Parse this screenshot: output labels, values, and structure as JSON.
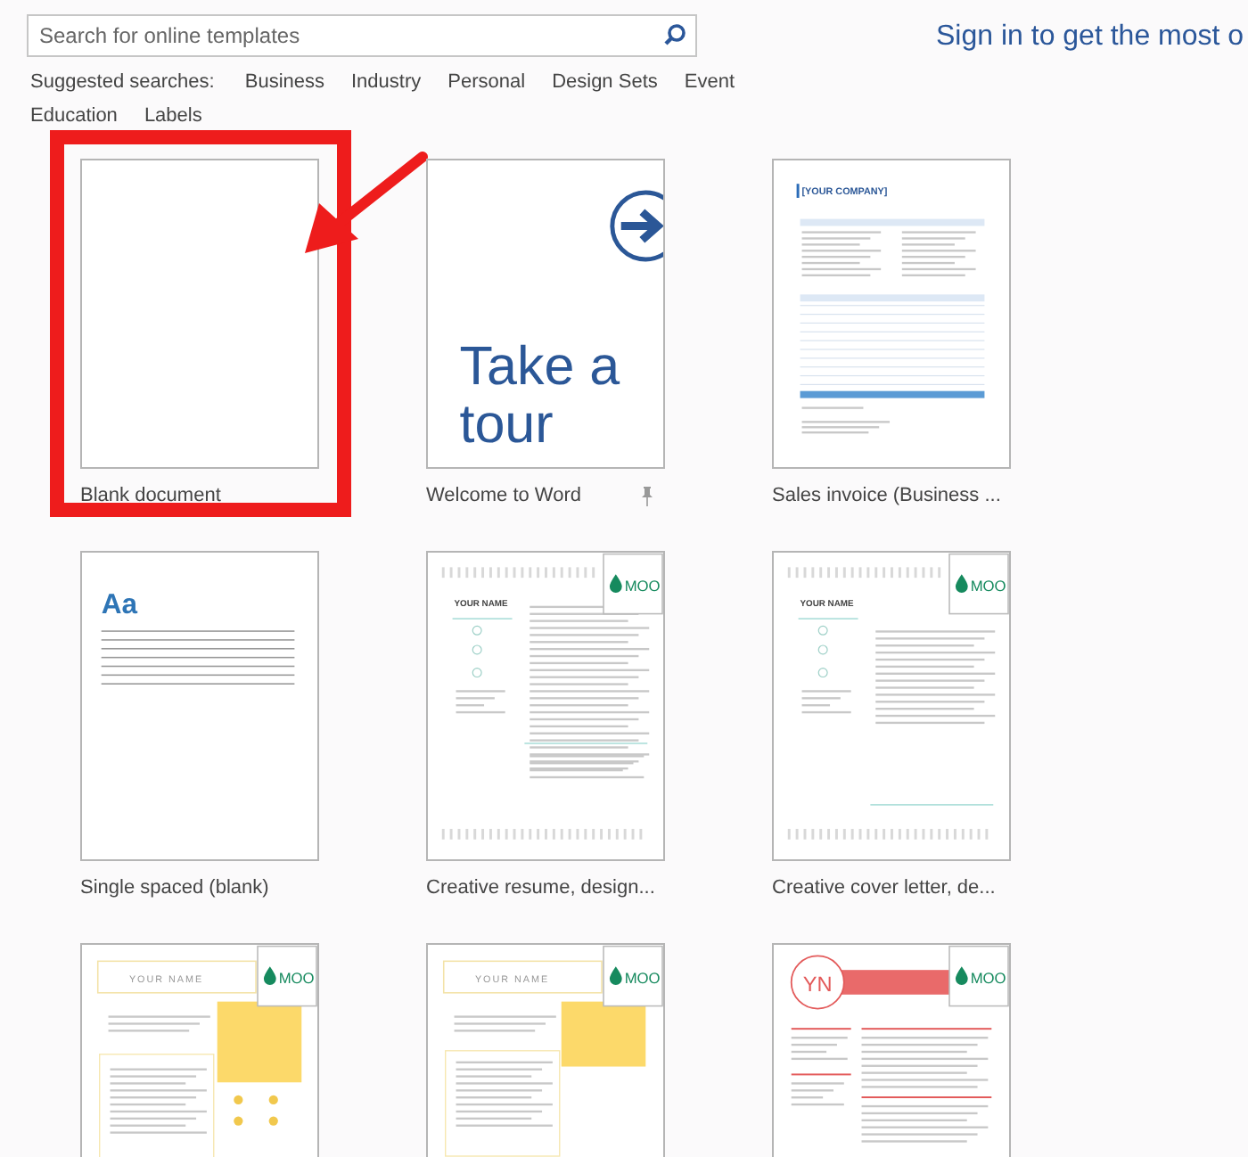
{
  "search": {
    "placeholder": "Search for online templates"
  },
  "sign_in": "Sign in to get the most o",
  "suggested": {
    "label": "Suggested searches:",
    "links": [
      "Business",
      "Industry",
      "Personal",
      "Design Sets",
      "Event",
      "Education",
      "Labels"
    ]
  },
  "templates": [
    {
      "title": "Blank document",
      "kind": "blank",
      "highlighted": true,
      "pinned": false
    },
    {
      "title": "Welcome to Word",
      "kind": "tour",
      "heading": "Take a tour",
      "highlighted": false,
      "pinned": true
    },
    {
      "title": "Sales invoice (Business ...",
      "kind": "invoice",
      "heading": "[YOUR COMPANY]",
      "highlighted": false,
      "pinned": false
    },
    {
      "title": "Single spaced (blank)",
      "kind": "lined",
      "heading": "Aa",
      "highlighted": false,
      "pinned": false
    },
    {
      "title": "Creative resume, design...",
      "kind": "resume",
      "heading": "YOUR NAME",
      "badge": "MOO",
      "highlighted": false,
      "pinned": false
    },
    {
      "title": "Creative cover letter, de...",
      "kind": "cover",
      "heading": "YOUR NAME",
      "badge": "MOO",
      "highlighted": false,
      "pinned": false
    },
    {
      "kind": "resume-yellow",
      "heading": "YOUR NAME",
      "badge": "MOO",
      "highlighted": false
    },
    {
      "kind": "letter-yellow",
      "heading": "YOUR NAME",
      "badge": "MOO",
      "highlighted": false
    },
    {
      "kind": "resume-red",
      "heading": "YN",
      "badge": "MOO",
      "highlighted": false
    }
  ]
}
